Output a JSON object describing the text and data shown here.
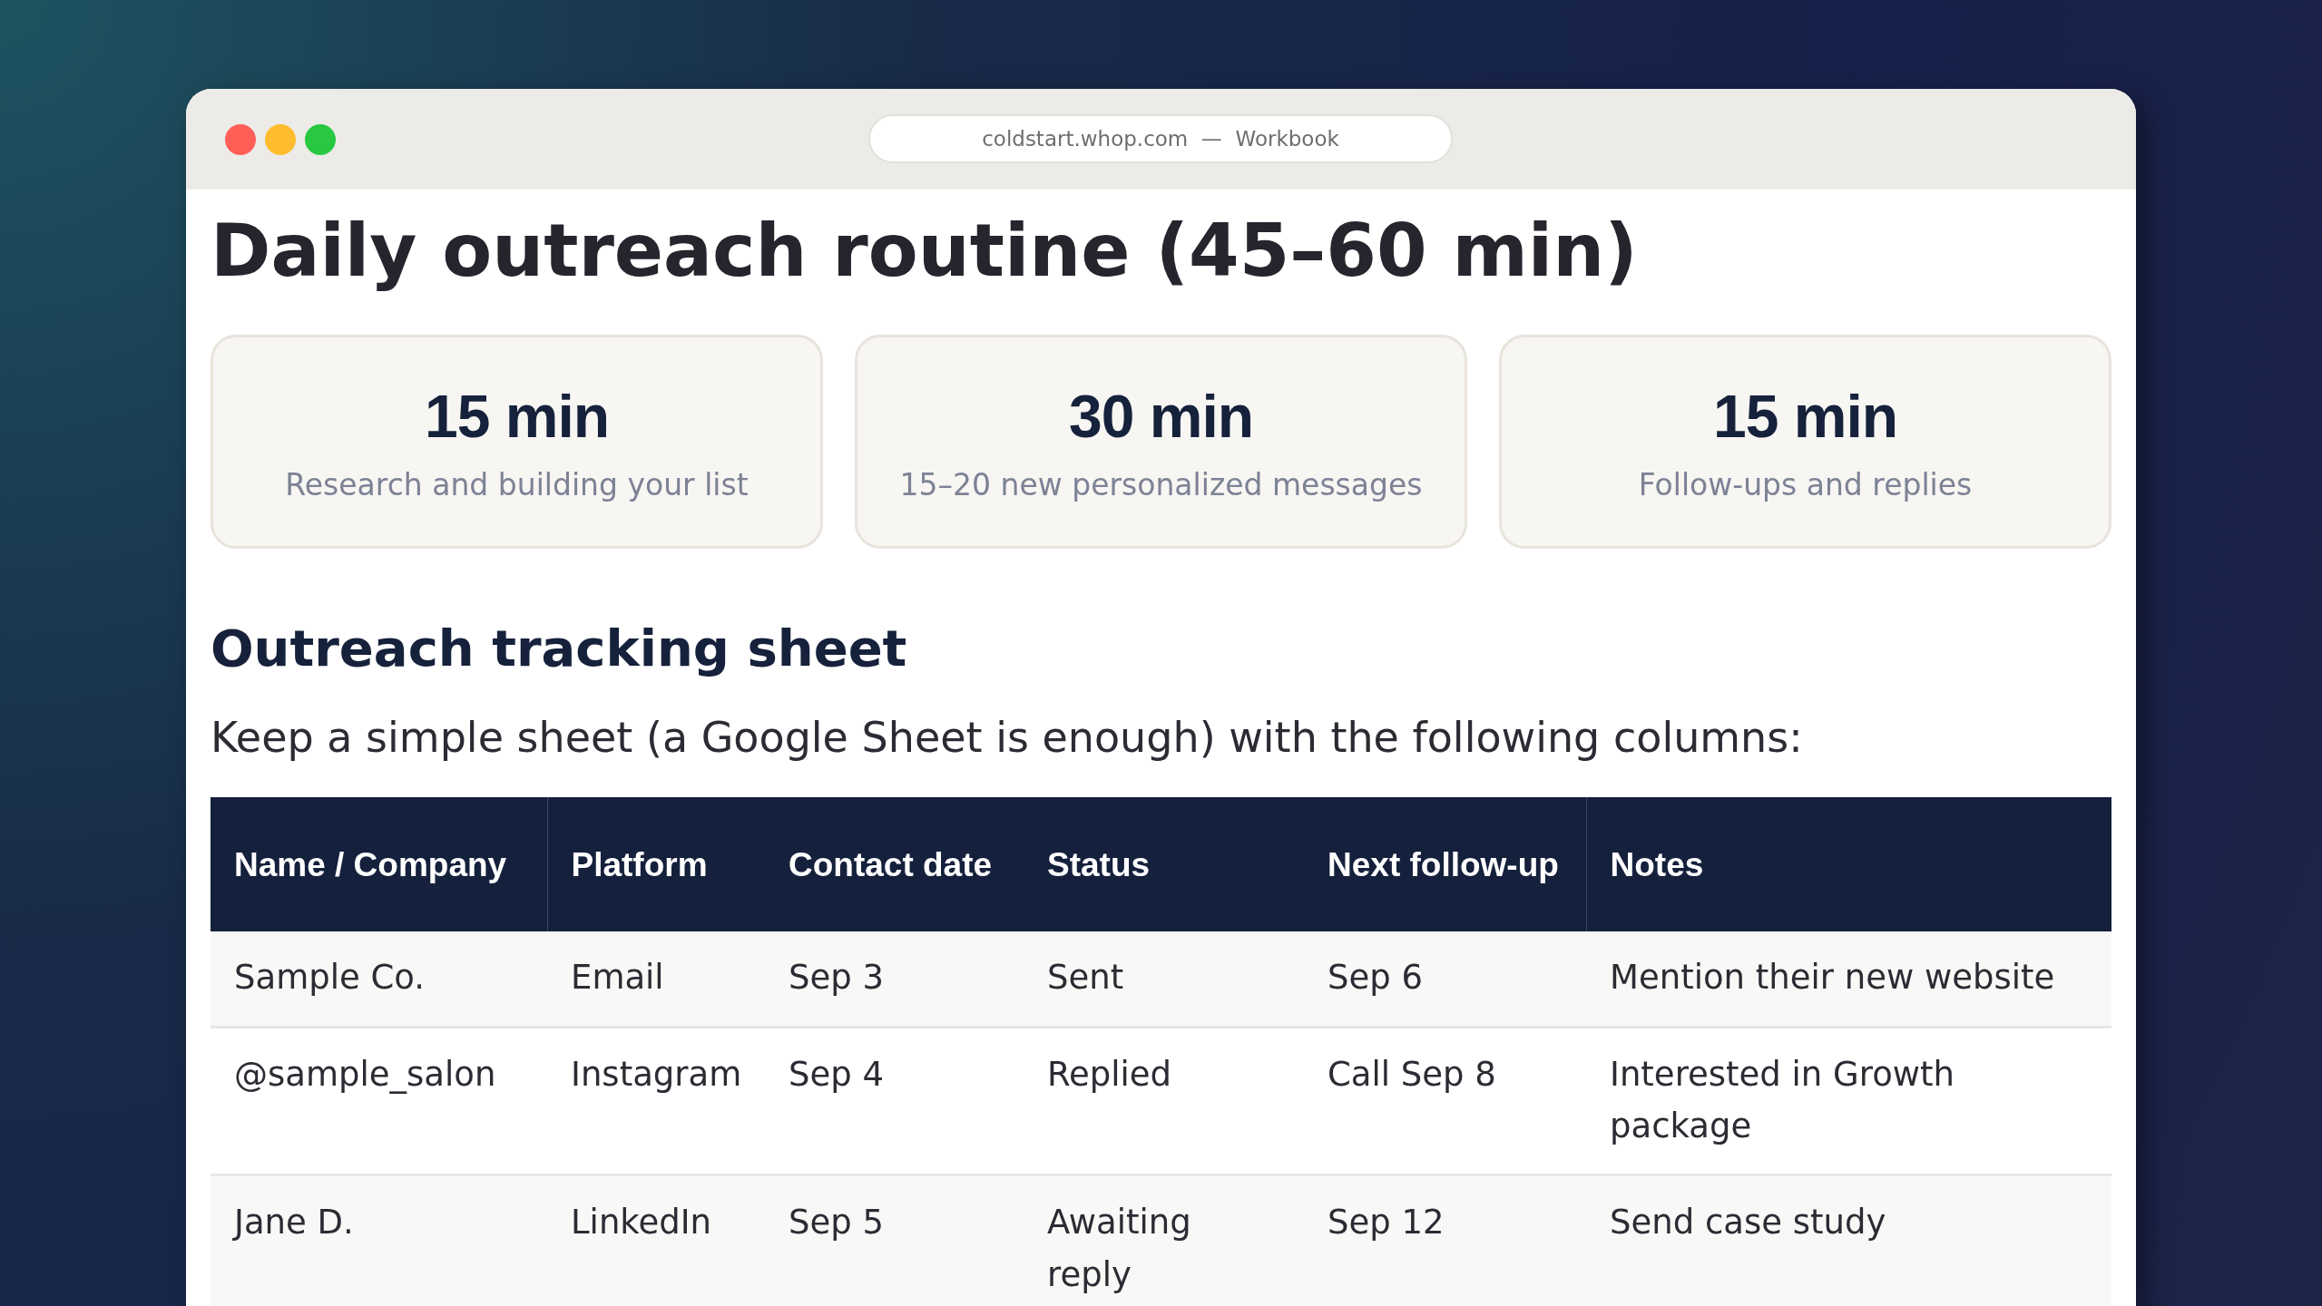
{
  "window": {
    "address": "coldstart.whop.com",
    "separator": "—",
    "page_title": "Workbook"
  },
  "title": "Daily outreach routine (45–60 min)",
  "cards": [
    {
      "value": "15 min",
      "label": "Research and building your list"
    },
    {
      "value": "30 min",
      "label": "15–20 new personalized messages"
    },
    {
      "value": "15 min",
      "label": "Follow-ups and replies"
    }
  ],
  "section": {
    "heading": "Outreach tracking sheet",
    "intro": "Keep a simple sheet (a Google Sheet is enough) with the following columns:"
  },
  "table": {
    "columns": [
      "Name / Company",
      "Platform",
      "Contact date",
      "Status",
      "Next follow-up",
      "Notes"
    ],
    "rows": [
      [
        "Sample Co.",
        "Email",
        "Sep 3",
        "Sent",
        "Sep 6",
        "Mention their new website"
      ],
      [
        "@sample_salon",
        "Instagram",
        "Sep 4",
        "Replied",
        "Call Sep 8",
        "Interested in Growth package"
      ],
      [
        "Jane D.",
        "LinkedIn",
        "Sep 5",
        "Awaiting reply",
        "Sep 12",
        "Send case study"
      ]
    ]
  }
}
